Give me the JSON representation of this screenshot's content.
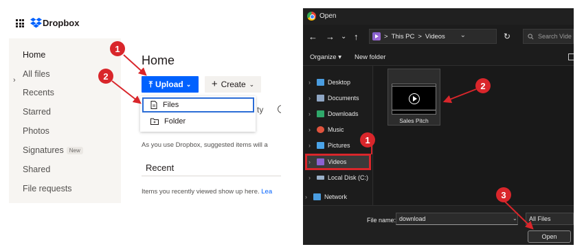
{
  "dropbox": {
    "brand": "Dropbox",
    "sidebar": {
      "items": [
        {
          "label": "Home"
        },
        {
          "label": "All files"
        },
        {
          "label": "Recents"
        },
        {
          "label": "Starred"
        },
        {
          "label": "Photos"
        },
        {
          "label": "Signatures"
        },
        {
          "label": "Shared"
        },
        {
          "label": "File requests"
        }
      ],
      "signatures_badge": "New"
    },
    "main": {
      "title": "Home",
      "upload_label": "Upload",
      "create_label": "Create",
      "upload_menu": {
        "files": "Files",
        "folder": "Folder"
      },
      "hidden_tail": "ty",
      "suggest_text": "As you use Dropbox, suggested items will a",
      "recent_title": "Recent",
      "recent_text": "Items you recently viewed show up here.",
      "recent_link": "Lea"
    }
  },
  "open_dialog": {
    "title": "Open",
    "breadcrumb": {
      "root": "This PC",
      "sep": ">",
      "folder": "Videos"
    },
    "search_placeholder": "Search Vide",
    "toolbar": {
      "organize": "Organize",
      "new_folder": "New folder"
    },
    "tree": [
      {
        "label": "Desktop",
        "icon": "desktop-icon",
        "color": "#4a9de0"
      },
      {
        "label": "Documents",
        "icon": "documents-icon",
        "color": "#8fa6c4"
      },
      {
        "label": "Downloads",
        "icon": "downloads-icon",
        "color": "#2fa86a"
      },
      {
        "label": "Music",
        "icon": "music-icon",
        "color": "#e0533d"
      },
      {
        "label": "Pictures",
        "icon": "pictures-icon",
        "color": "#4aa3e8"
      },
      {
        "label": "Videos",
        "icon": "videos-icon",
        "color": "#8b62d0"
      },
      {
        "label": "Local Disk (C:)",
        "icon": "disk-icon",
        "color": "#9ab0c8"
      },
      {
        "label": "Network",
        "icon": "network-icon",
        "color": "#4a9de0"
      }
    ],
    "file": {
      "name": "Sales Pitch"
    },
    "file_name_label": "File name:",
    "file_name_value": "download",
    "file_type": "All Files",
    "open_label": "Open"
  },
  "callouts": {
    "one": "1",
    "two": "2",
    "three": "3"
  },
  "colors": {
    "dropbox_blue": "#0061fe",
    "callout_red": "#d9262b",
    "highlight_blue": "#2a6cd6"
  }
}
